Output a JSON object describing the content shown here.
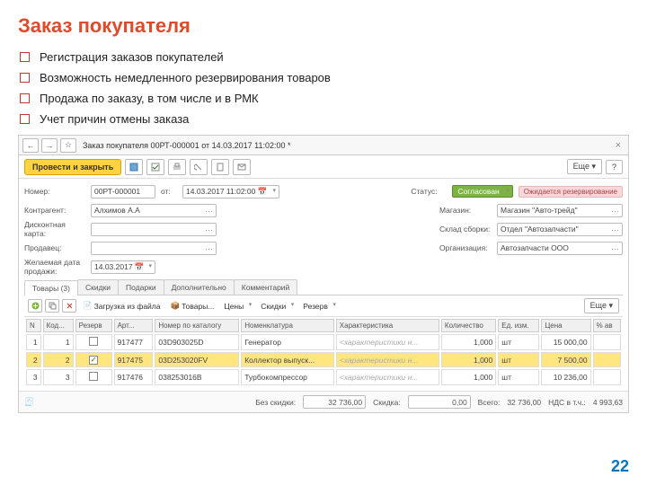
{
  "slide": {
    "title": "Заказ покупателя",
    "bullets": [
      "Регистрация заказов покупателей",
      "Возможность немедленного резервирования товаров",
      "Продажа по заказу, в том числе и в РМК",
      "Учет причин отмены заказа"
    ],
    "page_number": "22"
  },
  "window": {
    "title": "Заказ покупателя 00РТ-000001 от 14.03.2017 11:02:00 *",
    "actions": {
      "post_close": "Провести и закрыть",
      "more": "Еще",
      "help": "?"
    },
    "form": {
      "number_lbl": "Номер:",
      "number": "00РТ-000001",
      "from_lbl": "от:",
      "date": "14.03.2017 11:02:00",
      "status_lbl": "Статус:",
      "status": "Согласован",
      "status_badge": "Ожидается резервирование",
      "counterparty_lbl": "Контрагент:",
      "counterparty": "Алхимов А.А",
      "store_lbl": "Магазин:",
      "store": "Магазин \"Авто-трейд\"",
      "discount_card_lbl": "Дисконтная карта:",
      "discount_card": "",
      "warehouse_lbl": "Склад сборки:",
      "warehouse": "Отдел \"Автозапчасти\"",
      "seller_lbl": "Продавец:",
      "seller": "",
      "org_lbl": "Организация:",
      "org": "Автозапчасти ООО",
      "desired_date_lbl": "Желаемая дата продажи:",
      "desired_date": "14.03.2017"
    },
    "tabs": [
      "Товары (3)",
      "Скидки",
      "Подарки",
      "Дополнительно",
      "Комментарий"
    ],
    "tab_toolbar": {
      "load": "Загрузка из файла",
      "goods": "Товары...",
      "prices": "Цены",
      "discounts": "Скидки",
      "reserve": "Резерв",
      "more": "Еще"
    },
    "grid": {
      "cols": [
        "N",
        "Код...",
        "Резерв",
        "Арт...",
        "Номер по каталогу",
        "Номенклатура",
        "Характеристика",
        "Количество",
        "Ед. изм.",
        "Цена",
        "% ав"
      ],
      "rows": [
        {
          "n": "1",
          "code": "1",
          "reserve": false,
          "art": "917477",
          "cat": "03D903025D",
          "nom": "Генератор",
          "char": "<характеристики н...",
          "qty": "1,000",
          "unit": "шт",
          "price": "15 000,00"
        },
        {
          "n": "2",
          "code": "2",
          "reserve": true,
          "art": "917475",
          "cat": "03D253020FV",
          "nom": "Коллектор выпуск...",
          "char": "<характеристики н...",
          "qty": "1,000",
          "unit": "шт",
          "price": "7 500,00",
          "sel": true
        },
        {
          "n": "3",
          "code": "3",
          "reserve": false,
          "art": "917476",
          "cat": "038253016B",
          "nom": "Турбокомпрессор",
          "char": "<характеристики н...",
          "qty": "1,000",
          "unit": "шт",
          "price": "10 236,00"
        }
      ]
    },
    "totals": {
      "no_discount_lbl": "Без скидки:",
      "no_discount": "32 736,00",
      "discount_lbl": "Скидка:",
      "discount": "0,00",
      "total_lbl": "Всего:",
      "total": "32 736,00",
      "vat_lbl": "НДС в т.ч.:",
      "vat": "4 993,63"
    }
  }
}
